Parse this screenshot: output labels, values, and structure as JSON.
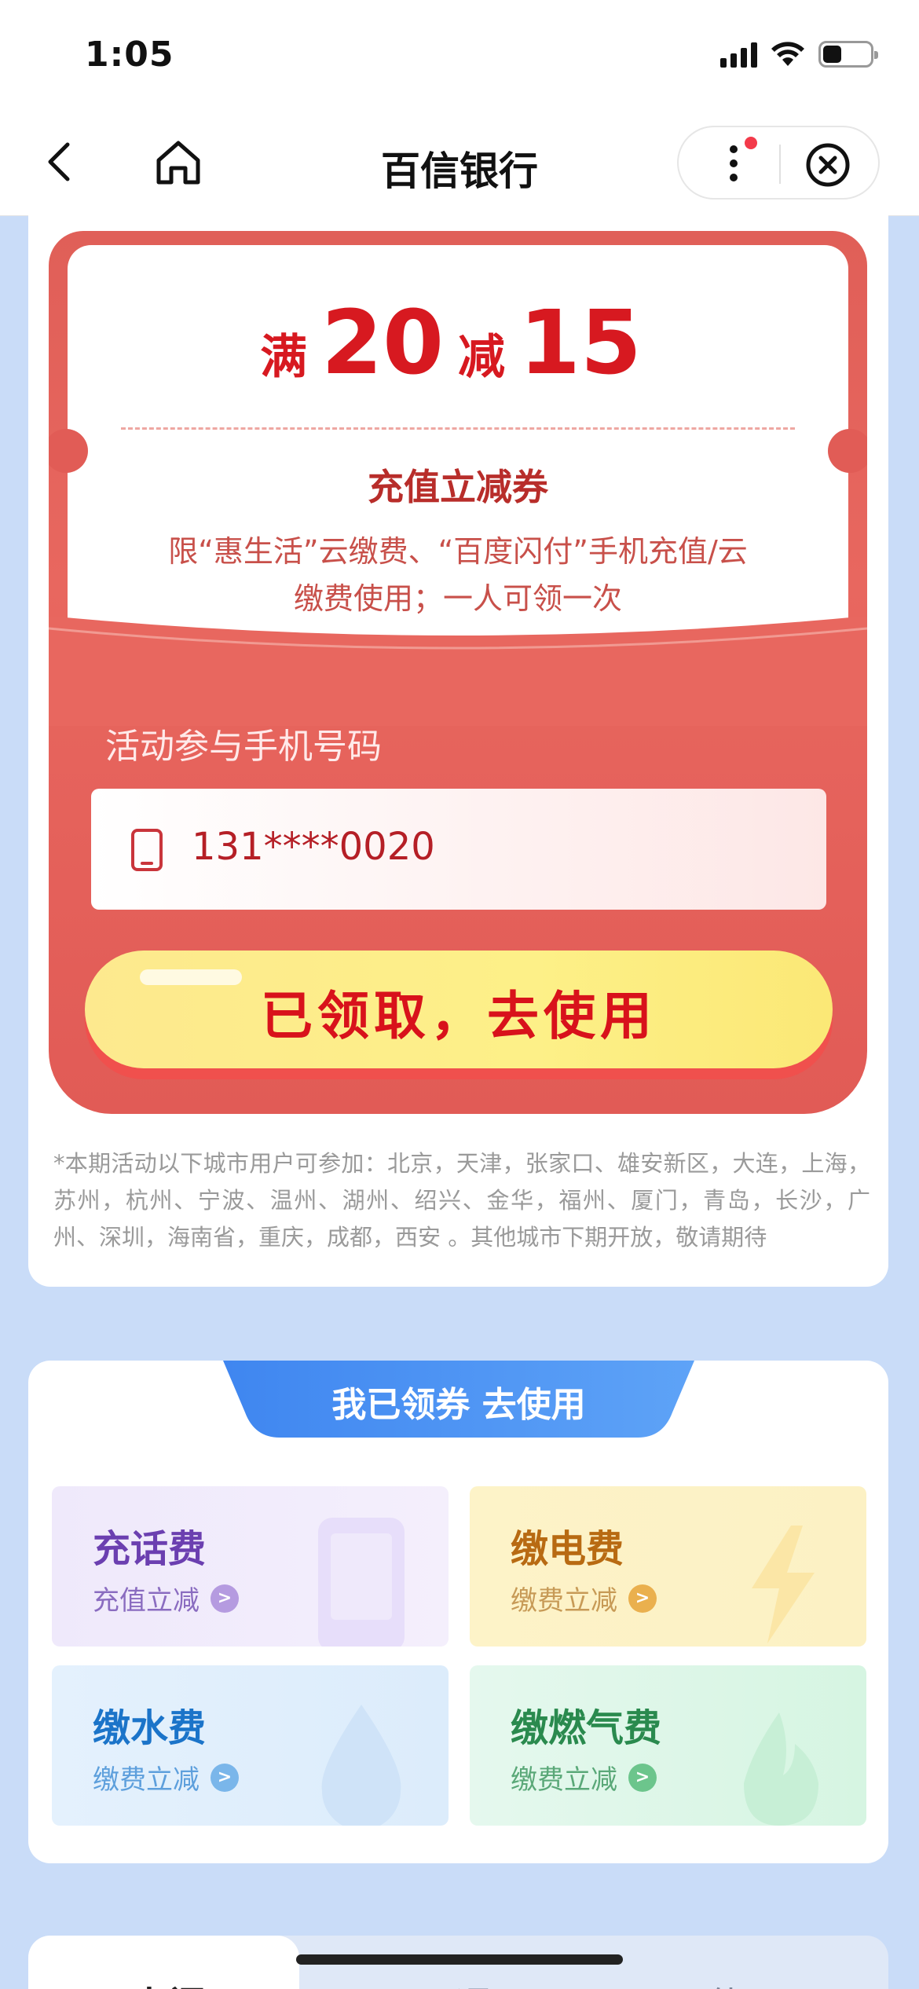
{
  "status_bar": {
    "time": "1:05"
  },
  "nav": {
    "title": "百信银行"
  },
  "coupon": {
    "prefix": "满",
    "threshold": "20",
    "middle": "减",
    "discount": "15",
    "title": "充值立减券",
    "description": "限“惠生活”云缴费、“百度闪付”手机充值/云缴费使用；一人可领一次",
    "phone_label": "活动参与手机号码",
    "phone_value": "131****0020",
    "button_label": "已领取，去使用"
  },
  "notice": "*本期活动以下城市用户可参加：北京，天津，张家口、雄安新区，大连，上海，苏州，杭州、宁波、温州、湖州、绍兴、金华，福州、厦门，青岛，长沙，广州、深圳，海南省，重庆，成都，西安 。其他城市下期开放，敬请期待",
  "services": {
    "banner": "我已领券 去使用",
    "items": [
      {
        "name": "充话费",
        "sub": "充值立减",
        "color": "#6b3fb0",
        "sub_color": "#8a6cc0",
        "arrow_color": "#b59be0",
        "icon": "phone-icon"
      },
      {
        "name": "缴电费",
        "sub": "缴费立减",
        "color": "#b86a12",
        "sub_color": "#c79a56",
        "arrow_color": "#eab04e",
        "icon": "lightning-icon"
      },
      {
        "name": "缴水费",
        "sub": "缴费立减",
        "color": "#1b74c9",
        "sub_color": "#5d9fdc",
        "arrow_color": "#7ab6ea",
        "icon": "water-drop-icon"
      },
      {
        "name": "缴燃气费",
        "sub": "缴费立减",
        "color": "#2a8a4e",
        "sub_color": "#5aa878",
        "arrow_color": "#6cc58c",
        "icon": "flame-icon"
      }
    ]
  },
  "bottom_tabs": [
    "出门",
    "开通",
    "使用"
  ]
}
